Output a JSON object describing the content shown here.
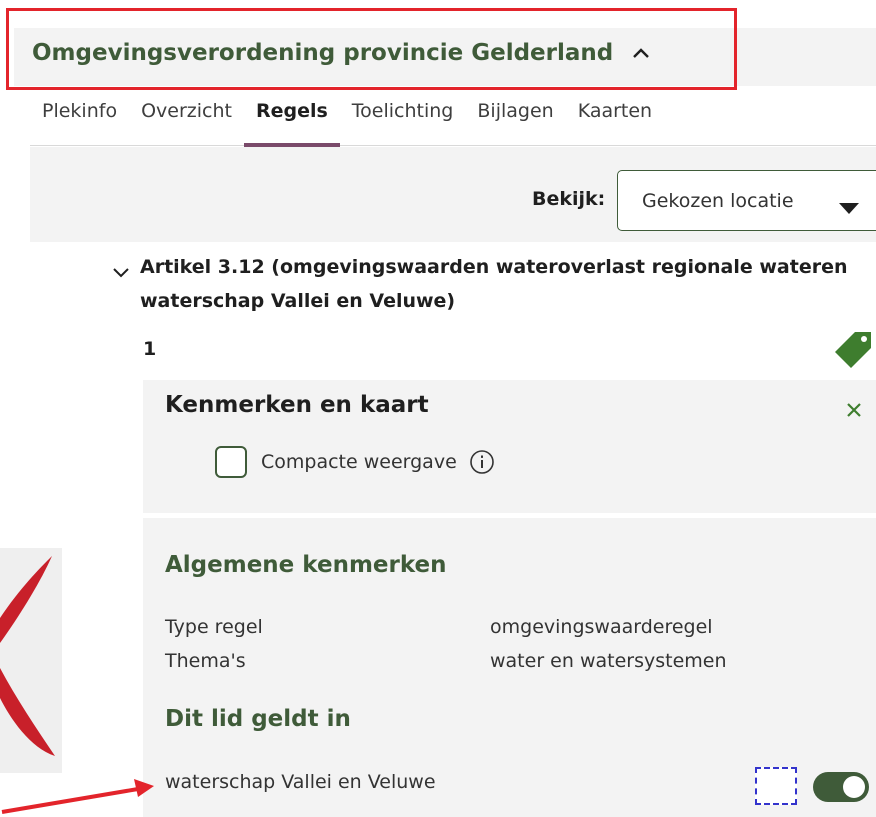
{
  "header": {
    "title": "Omgevingsverordening provincie Gelderland"
  },
  "tabs": [
    {
      "label": "Plekinfo",
      "active": false
    },
    {
      "label": "Overzicht",
      "active": false
    },
    {
      "label": "Regels",
      "active": true
    },
    {
      "label": "Toelichting",
      "active": false
    },
    {
      "label": "Bijlagen",
      "active": false
    },
    {
      "label": "Kaarten",
      "active": false
    }
  ],
  "view": {
    "label": "Bekijk:",
    "selected": "Gekozen locatie"
  },
  "artikel": {
    "title": "Artikel 3.12 (omgevingswaarden wateroverlast regionale wateren waterschap Vallei en Veluwe)",
    "lid_number": "1"
  },
  "kenmerken": {
    "title": "Kenmerken en kaart",
    "compact_label": "Compacte weergave",
    "compact_checked": false
  },
  "algemeen": {
    "title": "Algemene kenmerken",
    "rows": [
      {
        "key": "Type regel",
        "value": "omgevingswaarderegel"
      },
      {
        "key": "Thema's",
        "value": "water en watersystemen"
      }
    ],
    "geldt_title": "Dit lid geldt in",
    "gebied": "waterschap Vallei en Veluwe",
    "toggle_on": true
  },
  "colors": {
    "accent_green": "#3f5b39",
    "tag_green": "#3e7d2e",
    "active_tab_underline": "#7a4a6a",
    "annotation_red": "#e3242b",
    "dashed_blue": "#3333cc"
  },
  "icons": {
    "collapse": "chevron-up-icon",
    "dropdown": "caret-down-icon",
    "expand": "chevron-down-icon",
    "tag": "tag-icon",
    "close": "close-icon",
    "info": "info-icon"
  }
}
